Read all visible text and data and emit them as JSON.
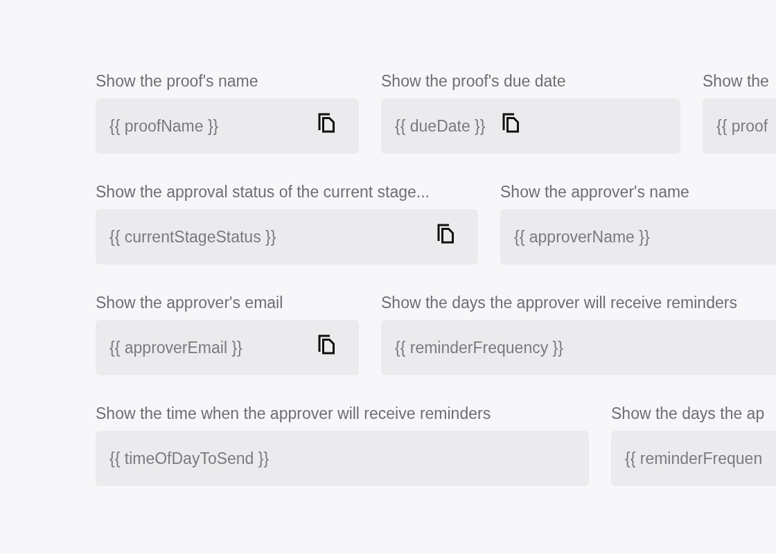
{
  "rows": [
    {
      "items": [
        {
          "label": "Show the proof's name",
          "value": "{{ proofName }}",
          "copy_icon": true
        },
        {
          "label": "Show the proof's due date",
          "value": "{{ dueDate }}",
          "copy_icon": true
        },
        {
          "label": "Show the",
          "value": "{{ proof"
        }
      ]
    },
    {
      "items": [
        {
          "label": "Show the approval status of the current stage...",
          "value": "{{ currentStageStatus }}",
          "copy_icon": true
        },
        {
          "label": "Show the approver's name",
          "value": "{{ approverName }}"
        }
      ]
    },
    {
      "items": [
        {
          "label": "Show the approver's email",
          "value": "{{ approverEmail }}",
          "copy_icon": true
        },
        {
          "label": "Show the days the approver will receive reminders",
          "value": "{{ reminderFrequency }}"
        }
      ]
    },
    {
      "items": [
        {
          "label": "Show the time when the approver will receive reminders",
          "value": "{{ timeOfDayToSend }}",
          "copy_icon": false
        },
        {
          "label": "Show the days the ap",
          "value": "{{ reminderFrequen"
        }
      ]
    }
  ]
}
